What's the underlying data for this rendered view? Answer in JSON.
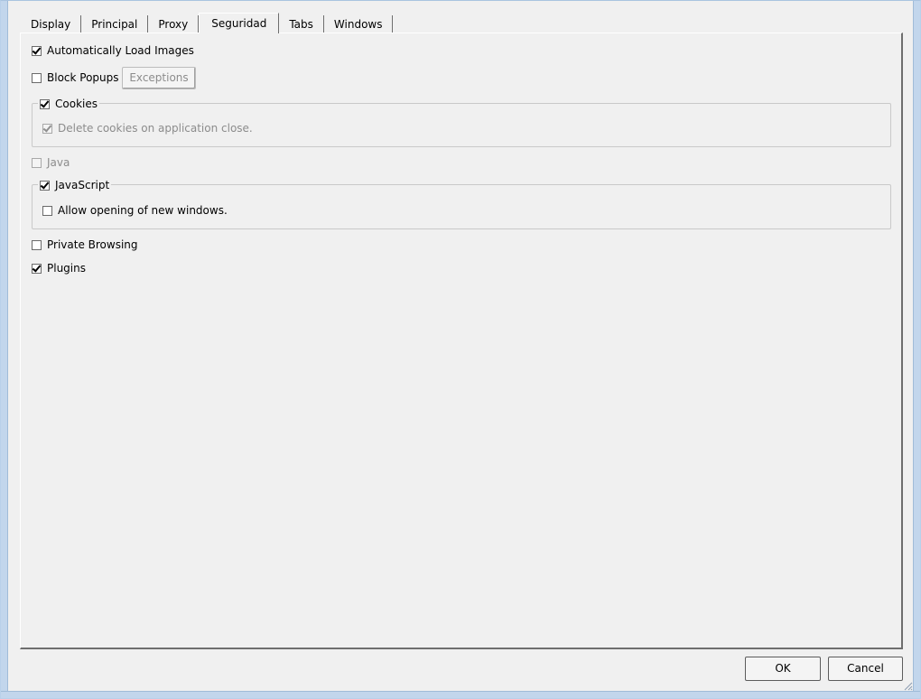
{
  "tabs": [
    {
      "label": "Display",
      "active": false
    },
    {
      "label": "Principal",
      "active": false
    },
    {
      "label": "Proxy",
      "active": false
    },
    {
      "label": "Seguridad",
      "active": true
    },
    {
      "label": "Tabs",
      "active": false
    },
    {
      "label": "Windows",
      "active": false
    }
  ],
  "security": {
    "auto_load_images": {
      "label": "Automatically Load Images",
      "checked": true,
      "enabled": true
    },
    "block_popups": {
      "label": "Block Popups",
      "checked": false,
      "enabled": true
    },
    "exceptions_button": {
      "label": "Exceptions",
      "enabled": false
    },
    "cookies": {
      "label": "Cookies",
      "checked": true,
      "enabled": true,
      "delete_on_close": {
        "label": "Delete cookies on application close.",
        "checked": true,
        "enabled": false
      }
    },
    "java": {
      "label": "Java",
      "checked": false,
      "enabled": false
    },
    "javascript": {
      "label": "JavaScript",
      "checked": true,
      "enabled": true,
      "allow_new_windows": {
        "label": "Allow opening of new windows.",
        "checked": false,
        "enabled": true
      }
    },
    "private_browsing": {
      "label": "Private Browsing",
      "checked": false,
      "enabled": true
    },
    "plugins": {
      "label": "Plugins",
      "checked": true,
      "enabled": true
    }
  },
  "footer": {
    "ok_label": "OK",
    "cancel_label": "Cancel"
  },
  "colors": {
    "window_bg": "#f0f0f0",
    "frame": "#c2d6ec",
    "disabled_text": "#8c8c8c"
  }
}
